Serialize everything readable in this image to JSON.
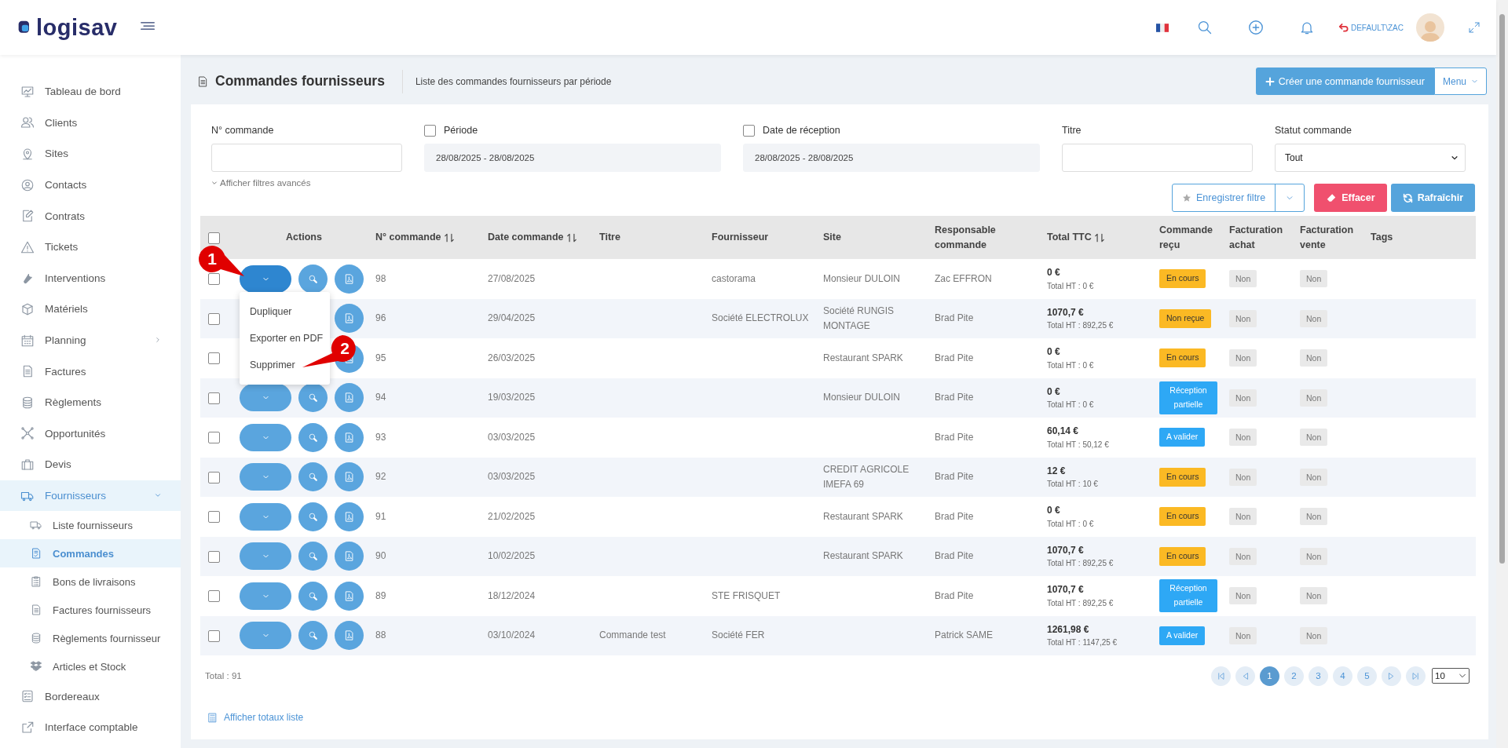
{
  "header": {
    "logo": "logisav",
    "user": "DEFAULT\\ZAC"
  },
  "sidebar": {
    "items": [
      {
        "label": "Tableau de bord",
        "selected": false
      },
      {
        "label": "Clients",
        "selected": false
      },
      {
        "label": "Sites",
        "selected": false
      },
      {
        "label": "Contacts",
        "selected": false
      },
      {
        "label": "Contrats",
        "selected": false
      },
      {
        "label": "Tickets",
        "selected": false
      },
      {
        "label": "Interventions",
        "selected": false
      },
      {
        "label": "Matériels",
        "selected": false
      },
      {
        "label": "Planning",
        "selected": false,
        "expanded": false
      },
      {
        "label": "Factures",
        "selected": false
      },
      {
        "label": "Règlements",
        "selected": false
      },
      {
        "label": "Opportunités",
        "selected": false
      },
      {
        "label": "Devis",
        "selected": false
      },
      {
        "label": "Fournisseurs",
        "selected": false,
        "expanded": true,
        "children": [
          {
            "label": "Liste fournisseurs",
            "selected": false
          },
          {
            "label": "Commandes",
            "selected": true
          },
          {
            "label": "Bons de livraisons",
            "selected": false
          },
          {
            "label": "Factures fournisseurs",
            "selected": false
          },
          {
            "label": "Règlements fournisseur",
            "selected": false
          },
          {
            "label": "Articles et Stock",
            "selected": false
          }
        ]
      },
      {
        "label": "Bordereaux",
        "selected": false
      },
      {
        "label": "Interface comptable",
        "selected": false
      }
    ]
  },
  "page": {
    "title": "Commandes fournisseurs",
    "subtitle": "Liste des commandes fournisseurs par période",
    "create_button": "Créer une commande fournisseur",
    "menu_button": "Menu"
  },
  "filters": {
    "fields": [
      {
        "label": "N° commande",
        "kind": "text"
      },
      {
        "label": "Période",
        "kind": "daterange",
        "checked": false,
        "value": "28/08/2025 - 28/08/2025"
      },
      {
        "label": "Date de réception",
        "kind": "daterange",
        "checked": false,
        "value": "28/08/2025 - 28/08/2025"
      },
      {
        "label": "Titre",
        "kind": "text"
      },
      {
        "label": "Statut commande",
        "kind": "select",
        "value": "Tout"
      }
    ],
    "advanced_link": "Afficher filtres avancés",
    "save_button": "Enregistrer filtre",
    "clear_button": "Effacer",
    "refresh_button": "Rafraîchir"
  },
  "table": {
    "select_all_checked": false,
    "columns": [
      {
        "label": "Actions",
        "sortable": false
      },
      {
        "label": "N° commande",
        "sortable": true
      },
      {
        "label": "Date commande",
        "sortable": true
      },
      {
        "label": "Titre",
        "sortable": false
      },
      {
        "label": "Fournisseur",
        "sortable": false
      },
      {
        "label": "Site",
        "sortable": false
      },
      {
        "label": "Responsable commande",
        "sortable": false
      },
      {
        "label": "Total TTC",
        "sortable": true
      },
      {
        "label": "Commande reçu",
        "sortable": false
      },
      {
        "label": "Facturation achat",
        "sortable": false
      },
      {
        "label": "Facturation vente",
        "sortable": false
      },
      {
        "label": "Tags",
        "sortable": false
      }
    ],
    "row_menu": [
      "Dupliquer",
      "Exporter en PDF",
      "Supprimer"
    ],
    "rows": [
      {
        "checked": false,
        "expanded": true,
        "number": "98",
        "date": "27/08/2025",
        "title": "",
        "supplier": "castorama",
        "site": "Monsieur DULOIN",
        "manager": "Zac EFFRON",
        "total_ttc": "0 €",
        "total_ht": "Total HT : 0 €",
        "status": {
          "label": "En cours",
          "kind": "warning"
        },
        "billing_purchase": "Non",
        "billing_sale": "Non"
      },
      {
        "checked": false,
        "expanded": false,
        "number": "96",
        "date": "29/04/2025",
        "title": "",
        "supplier": "Société ELECTROLUX",
        "site": "Société RUNGIS MONTAGE",
        "manager": "Brad Pite",
        "total_ttc": "1070,7 €",
        "total_ht": "Total HT : 892,25 €",
        "status": {
          "label": "Non reçue",
          "kind": "warning"
        },
        "billing_purchase": "Non",
        "billing_sale": "Non"
      },
      {
        "checked": false,
        "expanded": false,
        "number": "95",
        "date": "26/03/2025",
        "title": "",
        "supplier": "",
        "site": "Restaurant SPARK",
        "manager": "Brad Pite",
        "total_ttc": "0 €",
        "total_ht": "Total HT : 0 €",
        "status": {
          "label": "En cours",
          "kind": "warning"
        },
        "billing_purchase": "Non",
        "billing_sale": "Non"
      },
      {
        "checked": false,
        "expanded": false,
        "number": "94",
        "date": "19/03/2025",
        "title": "",
        "supplier": "",
        "site": "Monsieur DULOIN",
        "manager": "Brad Pite",
        "total_ttc": "0 €",
        "total_ht": "Total HT : 0 €",
        "status": {
          "label": "Réception partielle",
          "kind": "info"
        },
        "billing_purchase": "Non",
        "billing_sale": "Non"
      },
      {
        "checked": false,
        "expanded": false,
        "number": "93",
        "date": "03/03/2025",
        "title": "",
        "supplier": "",
        "site": "",
        "manager": "Brad Pite",
        "total_ttc": "60,14 €",
        "total_ht": "Total HT : 50,12 €",
        "status": {
          "label": "A valider",
          "kind": "info"
        },
        "billing_purchase": "Non",
        "billing_sale": "Non"
      },
      {
        "checked": false,
        "expanded": false,
        "number": "92",
        "date": "03/03/2025",
        "title": "",
        "supplier": "",
        "site": "CREDIT AGRICOLE IMEFA 69",
        "manager": "Brad Pite",
        "total_ttc": "12 €",
        "total_ht": "Total HT : 10 €",
        "status": {
          "label": "En cours",
          "kind": "warning"
        },
        "billing_purchase": "Non",
        "billing_sale": "Non"
      },
      {
        "checked": false,
        "expanded": false,
        "number": "91",
        "date": "21/02/2025",
        "title": "",
        "supplier": "",
        "site": "Restaurant SPARK",
        "manager": "Brad Pite",
        "total_ttc": "0 €",
        "total_ht": "Total HT : 0 €",
        "status": {
          "label": "En cours",
          "kind": "warning"
        },
        "billing_purchase": "Non",
        "billing_sale": "Non"
      },
      {
        "checked": false,
        "expanded": false,
        "number": "90",
        "date": "10/02/2025",
        "title": "",
        "supplier": "",
        "site": "Restaurant SPARK",
        "manager": "Brad Pite",
        "total_ttc": "1070,7 €",
        "total_ht": "Total HT : 892,25 €",
        "status": {
          "label": "En cours",
          "kind": "warning"
        },
        "billing_purchase": "Non",
        "billing_sale": "Non"
      },
      {
        "checked": false,
        "expanded": false,
        "number": "89",
        "date": "18/12/2024",
        "title": "",
        "supplier": "STE FRISQUET",
        "site": "",
        "manager": "Brad Pite",
        "total_ttc": "1070,7 €",
        "total_ht": "Total HT : 892,25 €",
        "status": {
          "label": "Réception partielle",
          "kind": "info"
        },
        "billing_purchase": "Non",
        "billing_sale": "Non"
      },
      {
        "checked": false,
        "expanded": false,
        "number": "88",
        "date": "03/10/2024",
        "title": "Commande test",
        "supplier": "Société FER",
        "site": "",
        "manager": "Patrick SAME",
        "total_ttc": "1261,98 €",
        "total_ht": "Total HT : 1147,25 €",
        "status": {
          "label": "A valider",
          "kind": "info"
        },
        "billing_purchase": "Non",
        "billing_sale": "Non"
      }
    ]
  },
  "total": "Total : 91",
  "pagination": {
    "pages": [
      {
        "label": "1",
        "selected": true
      },
      {
        "label": "2",
        "selected": false
      },
      {
        "label": "3",
        "selected": false
      },
      {
        "label": "4",
        "selected": false
      },
      {
        "label": "5",
        "selected": false
      }
    ],
    "page_size": "10"
  },
  "totals_link": "Afficher totaux liste",
  "callouts": [
    "1",
    "2"
  ]
}
